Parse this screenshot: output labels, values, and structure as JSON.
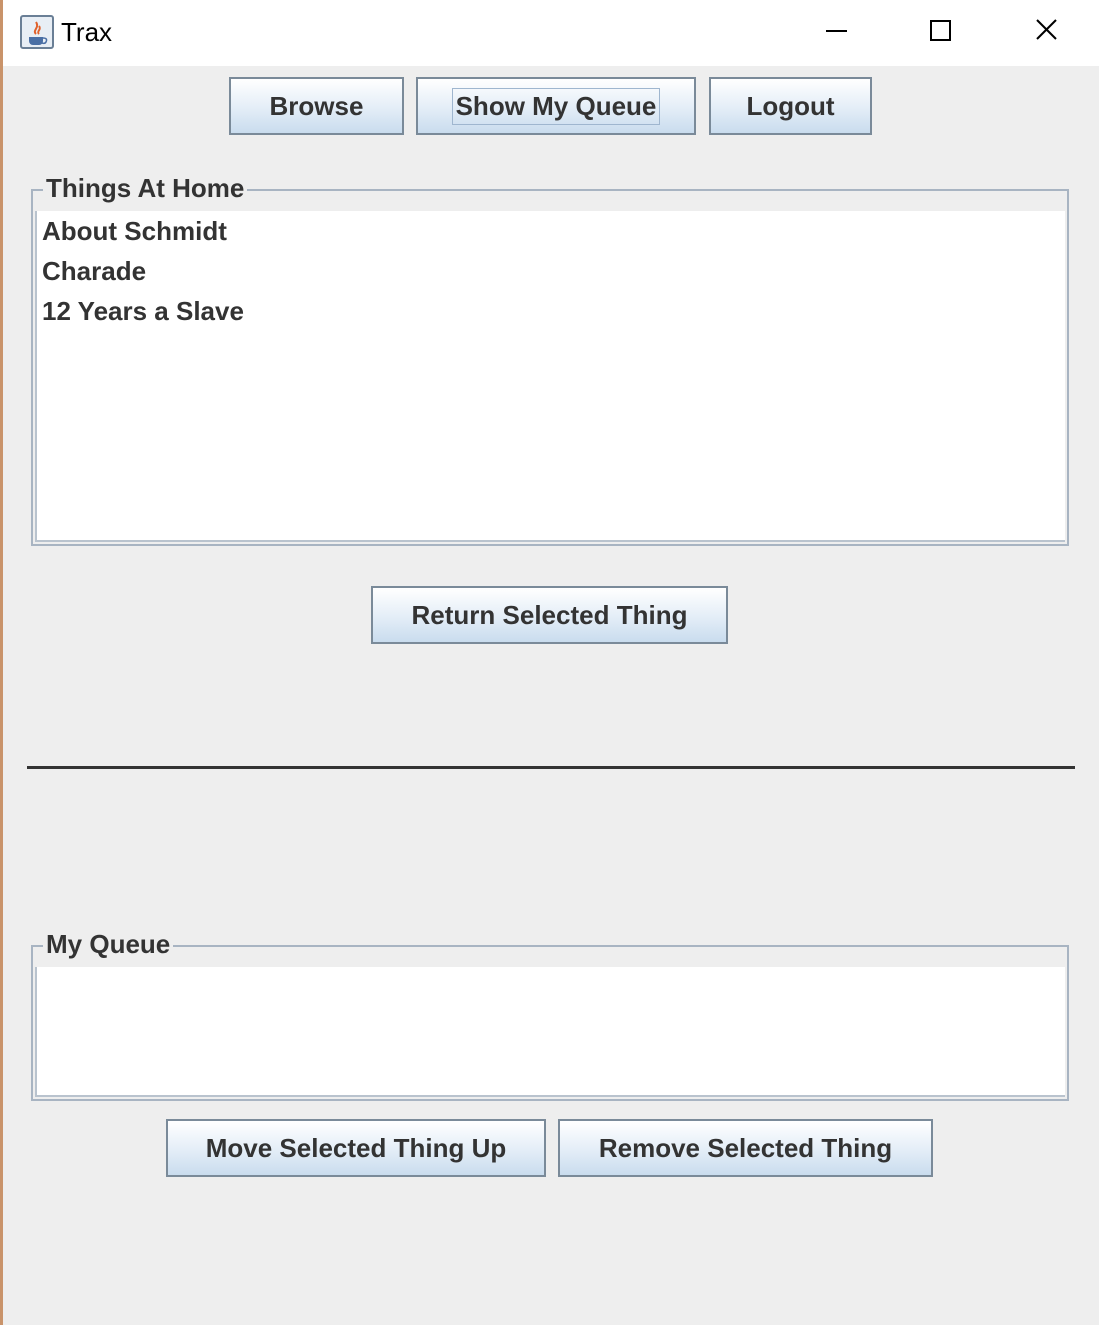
{
  "window": {
    "title": "Trax",
    "icons": {
      "app": "java-coffee-icon",
      "minimize": "minimize-icon",
      "maximize": "maximize-icon",
      "close": "close-icon"
    }
  },
  "toolbar": {
    "browse_label": "Browse",
    "show_queue_label": "Show My Queue",
    "logout_label": "Logout"
  },
  "things_at_home": {
    "title": "Things At Home",
    "items": [
      "About Schmidt",
      "Charade",
      "12 Years a Slave"
    ],
    "return_label": "Return Selected Thing"
  },
  "my_queue": {
    "title": "My Queue",
    "items": [],
    "move_up_label": "Move Selected Thing Up",
    "remove_label": "Remove Selected Thing"
  },
  "colors": {
    "window_bg": "#eeeeee",
    "button_gradient_bottom": "#c9dcee",
    "text": "#333333"
  }
}
